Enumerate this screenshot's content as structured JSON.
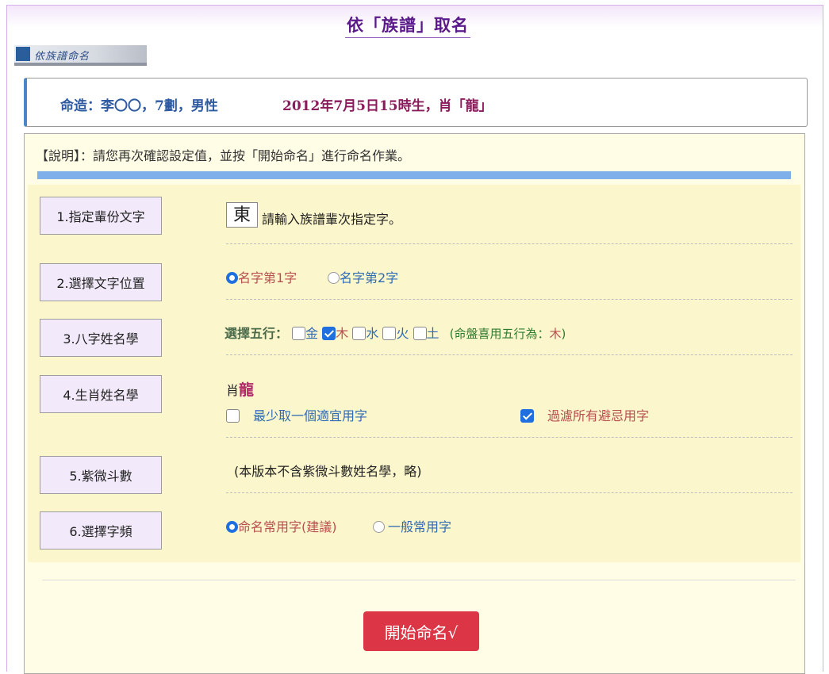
{
  "page": {
    "title": "依「族譜」取名",
    "banner": "依族譜命名"
  },
  "destiny": {
    "prefix": "命造：李〇〇，7劃，男性",
    "suffix": "2012年7月5日15時生，肖「龍」"
  },
  "explain": "【說明】：請您再次確認設定值，並按「開始命名」進行命名作業。",
  "rows": {
    "r1": {
      "label": "1.指定輩份文字",
      "char": "東",
      "hint": "請輸入族譜輩次指定字。"
    },
    "r2": {
      "label": "2.選擇文字位置",
      "opt1": "名字第1字",
      "opt2": "名字第2字",
      "selected": "名字第1字"
    },
    "r3": {
      "label": "3.八字姓名學",
      "prefix": "選擇五行：",
      "elements": [
        "金",
        "木",
        "水",
        "火",
        "土"
      ],
      "checked": [
        "木"
      ],
      "note_prefix": "(命盤喜用五行為：",
      "note_value": "木",
      "note_suffix": ")"
    },
    "r4": {
      "label": "4.生肖姓名學",
      "zodiac_prefix": "肖",
      "zodiac": "龍",
      "opt_min": "最少取一個適宜用字",
      "opt_filter": "過濾所有避忌用字",
      "min_checked": false,
      "filter_checked": true
    },
    "r5": {
      "label": "5.紫微斗數",
      "note": "(本版本不含紫微斗數姓名學，略)"
    },
    "r6": {
      "label": "6.選擇字頻",
      "opt1": "命名常用字(建議)",
      "opt2": "一般常用字",
      "selected": "命名常用字(建議)"
    }
  },
  "start_button": "開始命名√",
  "colors": {
    "title": "#5a1a8a",
    "start_button": "#dc3545",
    "accent_bar": "#7fb0ea",
    "form_bg": "#fcf6cc",
    "label_bg": "#f2e9fb"
  }
}
